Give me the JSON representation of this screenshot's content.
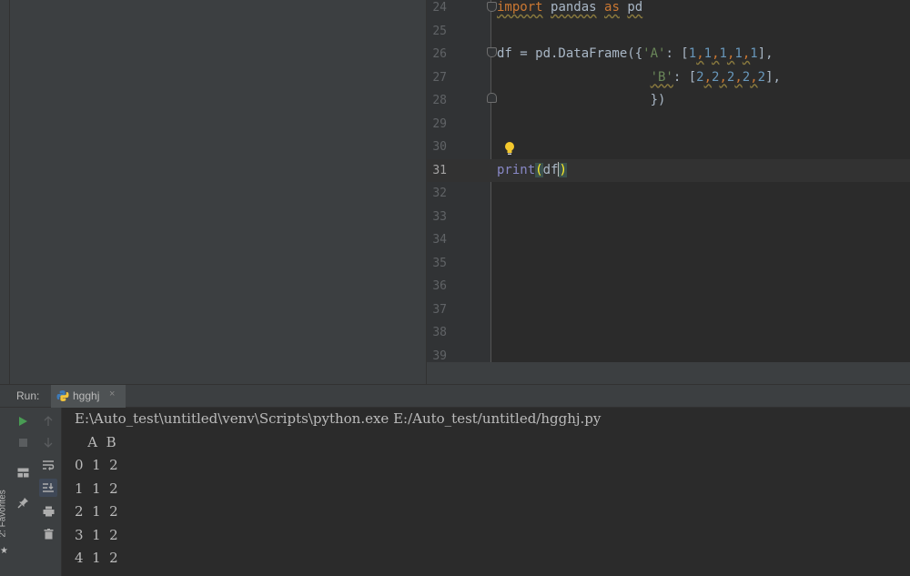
{
  "editor": {
    "lines": [
      {
        "num": "24"
      },
      {
        "num": "25"
      },
      {
        "num": "26"
      },
      {
        "num": "27"
      },
      {
        "num": "28"
      },
      {
        "num": "29"
      },
      {
        "num": "30"
      },
      {
        "num": "31"
      },
      {
        "num": "32"
      },
      {
        "num": "33"
      },
      {
        "num": "34"
      },
      {
        "num": "35"
      },
      {
        "num": "36"
      },
      {
        "num": "37"
      },
      {
        "num": "38"
      },
      {
        "num": "39"
      }
    ],
    "current_line": "31",
    "code": {
      "l24_kw": "import",
      "l24_mod": "pandas",
      "l24_as": "as",
      "l24_alias": "pd",
      "l26_df": "df",
      "l26_eq": " = pd.DataFrame({",
      "l26_key": "'A'",
      "l26_colon": ": [",
      "l26_vals": [
        "1",
        "1",
        "1",
        "1",
        "1"
      ],
      "l26_end": "],",
      "l27_key": "'B'",
      "l27_colon": ": [",
      "l27_vals": [
        "2",
        "2",
        "2",
        "2",
        "2"
      ],
      "l27_end": "],",
      "l28_text": "})",
      "l31_fn": "print",
      "l31_open": "(",
      "l31_arg": "df",
      "l31_close": ")"
    }
  },
  "run": {
    "label": "Run:",
    "tab_name": "hgghj",
    "tab_close": "×"
  },
  "favorites": {
    "label": "2: Favorites"
  },
  "console": {
    "command": "E:\\Auto_test\\untitled\\venv\\Scripts\\python.exe E:/Auto_test/untitled/hgghj.py",
    "header": "   A  B",
    "rows": [
      "0  1  2",
      "1  1  2",
      "2  1  2",
      "3  1  2",
      "4  1  2"
    ]
  },
  "colors": {
    "keyword": "#cc7832",
    "string": "#6a8759",
    "number": "#6897bb",
    "builtin": "#8888c6",
    "run_green": "#499c54"
  },
  "icons": [
    "run-icon",
    "stop-icon",
    "up-arrow-icon",
    "down-arrow-icon",
    "layout-icon",
    "soft-wrap-icon",
    "pin-icon",
    "scroll-to-end-icon",
    "print-icon",
    "trash-icon",
    "python-icon",
    "bulb-icon",
    "star-icon"
  ]
}
